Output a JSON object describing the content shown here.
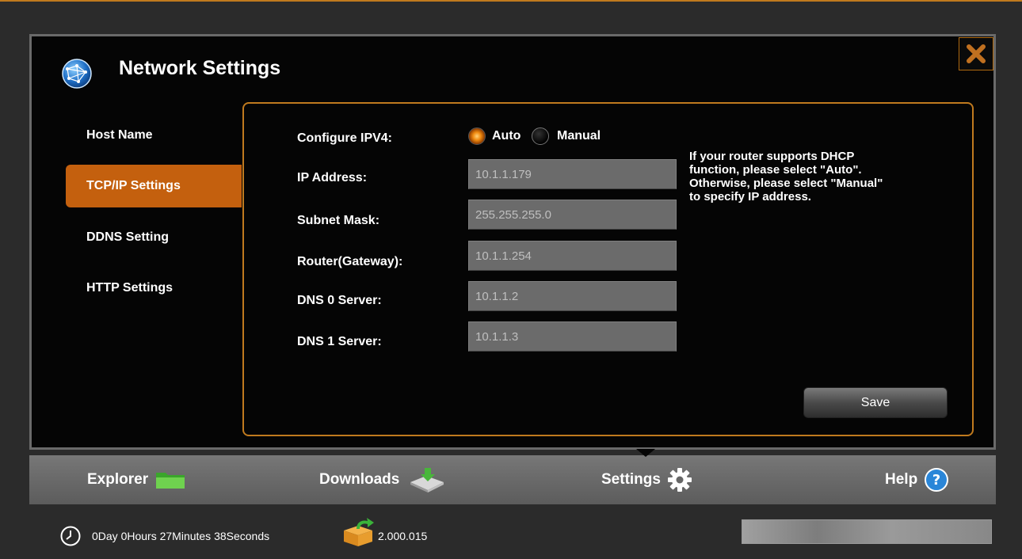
{
  "app": {
    "title": "Network Settings"
  },
  "sidebar": {
    "items": [
      {
        "label": "Host Name",
        "active": false
      },
      {
        "label": "TCP/IP Settings",
        "active": true
      },
      {
        "label": "DDNS Setting",
        "active": false
      },
      {
        "label": "HTTP Settings",
        "active": false
      }
    ]
  },
  "form": {
    "configure_label": "Configure IPV4:",
    "mode_options": [
      "Auto",
      "Manual"
    ],
    "selected_mode": "Auto",
    "fields": [
      {
        "label": "IP Address:",
        "value": "10.1.1.179"
      },
      {
        "label": "Subnet Mask:",
        "value": "255.255.255.0"
      },
      {
        "label": "Router(Gateway):",
        "value": "10.1.1.254"
      },
      {
        "label": "DNS 0 Server:",
        "value": "10.1.1.2"
      },
      {
        "label": "DNS 1 Server:",
        "value": "10.1.1.3"
      }
    ],
    "help_lines": [
      "If your router supports DHCP",
      "function, please select \"Auto\".",
      "Otherwise, please select \"Manual\"",
      "to specify IP address."
    ],
    "save_label": "Save"
  },
  "tabs": [
    {
      "label": "Explorer",
      "icon": "folder-icon"
    },
    {
      "label": "Downloads",
      "icon": "download-drive-icon"
    },
    {
      "label": "Settings",
      "icon": "gear-icon",
      "active": true
    },
    {
      "label": "Help",
      "icon": "help-icon"
    }
  ],
  "status": {
    "uptime": "0Day 0Hours 27Minutes 38Seconds",
    "version": "2.000.015"
  },
  "colors": {
    "accent": "#c4600e",
    "panel_border": "#c07a1e",
    "background": "#050505"
  }
}
